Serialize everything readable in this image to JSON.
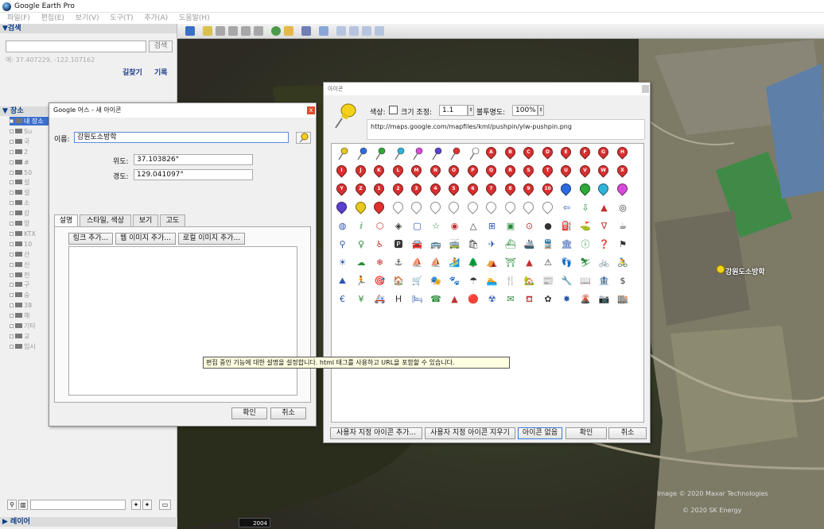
{
  "window": {
    "title": "Google Earth Pro"
  },
  "menu": [
    "파일(F)",
    "편집(E)",
    "보기(V)",
    "도구(T)",
    "추가(A)",
    "도움말(H)"
  ],
  "sidebar": {
    "search_head": "▼검색",
    "search_button": "검색",
    "search_hint": "예: 37.407229, -122.107162",
    "directions_link": "길찾기",
    "history_link": "기록",
    "places_head": "▼ 장소",
    "tree": [
      "내 장소",
      "Su",
      "국",
      "2",
      "#",
      "50",
      "설",
      "설",
      "소",
      "강",
      "양",
      "KTX",
      "10",
      "산",
      "신",
      "천",
      "구",
      "승",
      "38",
      "해",
      "기타",
      "교",
      "임시"
    ],
    "layers_head": "▶ 레이어"
  },
  "map": {
    "attribution_1": "Image © 2020 Maxar Technologies",
    "attribution_2": "© 2020 SK Energy",
    "year": "2004",
    "pin_label": "강원도소방학"
  },
  "placemark_dialog": {
    "title": "Google 어스 - 새 아이콘",
    "close": "x",
    "name_label": "이름:",
    "name_value": "강원도소방학",
    "lat_label": "위도:",
    "lat_value": "37.103826°",
    "lon_label": "경도:",
    "lon_value": "129.041097°",
    "tabs": [
      "설명",
      "스타일, 색상",
      "보기",
      "고도"
    ],
    "buttons": {
      "link": "링크 추가...",
      "web_image": "웹 이미지 추가...",
      "local_image": "로컬 이미지 추가...",
      "ok": "확인",
      "cancel": "취소"
    },
    "tooltip": "편집 중인 기능에 대한 설명을 설정합니다. html 태그를 사용하고 URL을 포함할 수 있습니다."
  },
  "icon_dialog": {
    "title": "아이콘",
    "color_label": "색상:",
    "scale_label": "크기 조정:",
    "scale_value": "1.1",
    "opacity_label": "불투명도:",
    "opacity_value": "100%",
    "url": "http://maps.google.com/mapfiles/kml/pushpin/ylw-pushpin.png",
    "buttons": {
      "add_custom": "사용자 지정 아이콘 추가...",
      "clear_custom": "사용자 지정 아이콘 지우기",
      "no_icon": "아이콘 없음",
      "ok": "확인",
      "cancel": "취소"
    },
    "pushpin_colors": [
      "#e8c81a",
      "#2b6be0",
      "#2fa83a",
      "#2fb3d8",
      "#d84ad8",
      "#5a3fd0",
      "#e03030",
      "#ffffff"
    ],
    "letters": [
      "A",
      "B",
      "C",
      "D",
      "E",
      "F",
      "G",
      "H",
      "I",
      "J",
      "K",
      "L",
      "M",
      "N",
      "O",
      "P",
      "Q",
      "R",
      "S",
      "T",
      "U",
      "V",
      "W",
      "X",
      "Y",
      "Z"
    ],
    "numbers": [
      "1",
      "2",
      "3",
      "4",
      "5",
      "6",
      "7",
      "8",
      "9",
      "10"
    ],
    "dot_colors": [
      "#2b6be0",
      "#2fa83a",
      "#2fb3d8",
      "#d84ad8",
      "#5a3fd0",
      "#e8c81a",
      "#e03030",
      "#ffffff"
    ],
    "misc_glyphs": [
      "⇦",
      "⇩",
      "▲",
      "◎",
      "◍",
      "ⅈ",
      "⬡",
      "◈",
      "▢",
      "☆",
      "◉",
      "△",
      "⊞",
      "▣",
      "⊙",
      "●",
      "⛽",
      "⛳",
      "∇",
      "☕",
      "⚲",
      "♀",
      "♿",
      "🅿",
      "🚘",
      "🚌",
      "🚎",
      "🛍",
      "✈",
      "⛴",
      "🚢",
      "🚆",
      "🏛",
      "ⓘ",
      "❓",
      "⚑",
      "☀",
      "☁",
      "❄",
      "⚓",
      "⛵",
      "⛵",
      "🏄",
      "🌲",
      "⛺",
      "⛩",
      "▲",
      "⚠",
      "👣",
      "⛷",
      "🚲",
      "🚴",
      "⛰",
      "🏃",
      "🎯",
      "🏠",
      "🛒",
      "🎭",
      "🐾",
      "☂",
      "🏊",
      "🍴",
      "🏡",
      "📰",
      "🔧",
      "📖",
      "🏦",
      "$",
      "€",
      "¥",
      "🚑",
      "H",
      "🛏",
      "☎",
      "▲",
      "🔴",
      "☢",
      "✉",
      "⛾",
      "✿",
      "✸",
      "🌋",
      "📷",
      "🏬"
    ]
  }
}
